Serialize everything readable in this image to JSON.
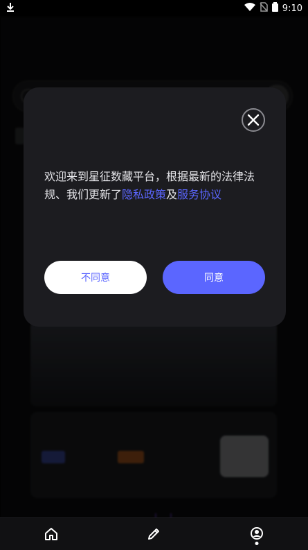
{
  "status_bar": {
    "time": "9:10",
    "icons": [
      "download-icon",
      "wifi-icon",
      "no-sim-icon",
      "battery-icon"
    ]
  },
  "dialog": {
    "message_prefix": "欢迎来到星征数藏平台，根据最新的法律法规、我们更新了",
    "privacy_link": "隐私政策",
    "conjunction": "及",
    "service_link": "服务协议",
    "disagree_label": "不同意",
    "agree_label": "同意"
  },
  "bottom_nav": {
    "items": [
      {
        "name": "home-icon"
      },
      {
        "name": "pencil-icon"
      },
      {
        "name": "profile-icon",
        "active": true
      }
    ]
  },
  "colors": {
    "accent": "#5b66ff",
    "dialog_bg": "#1c1c20",
    "page_bg": "#000000"
  }
}
